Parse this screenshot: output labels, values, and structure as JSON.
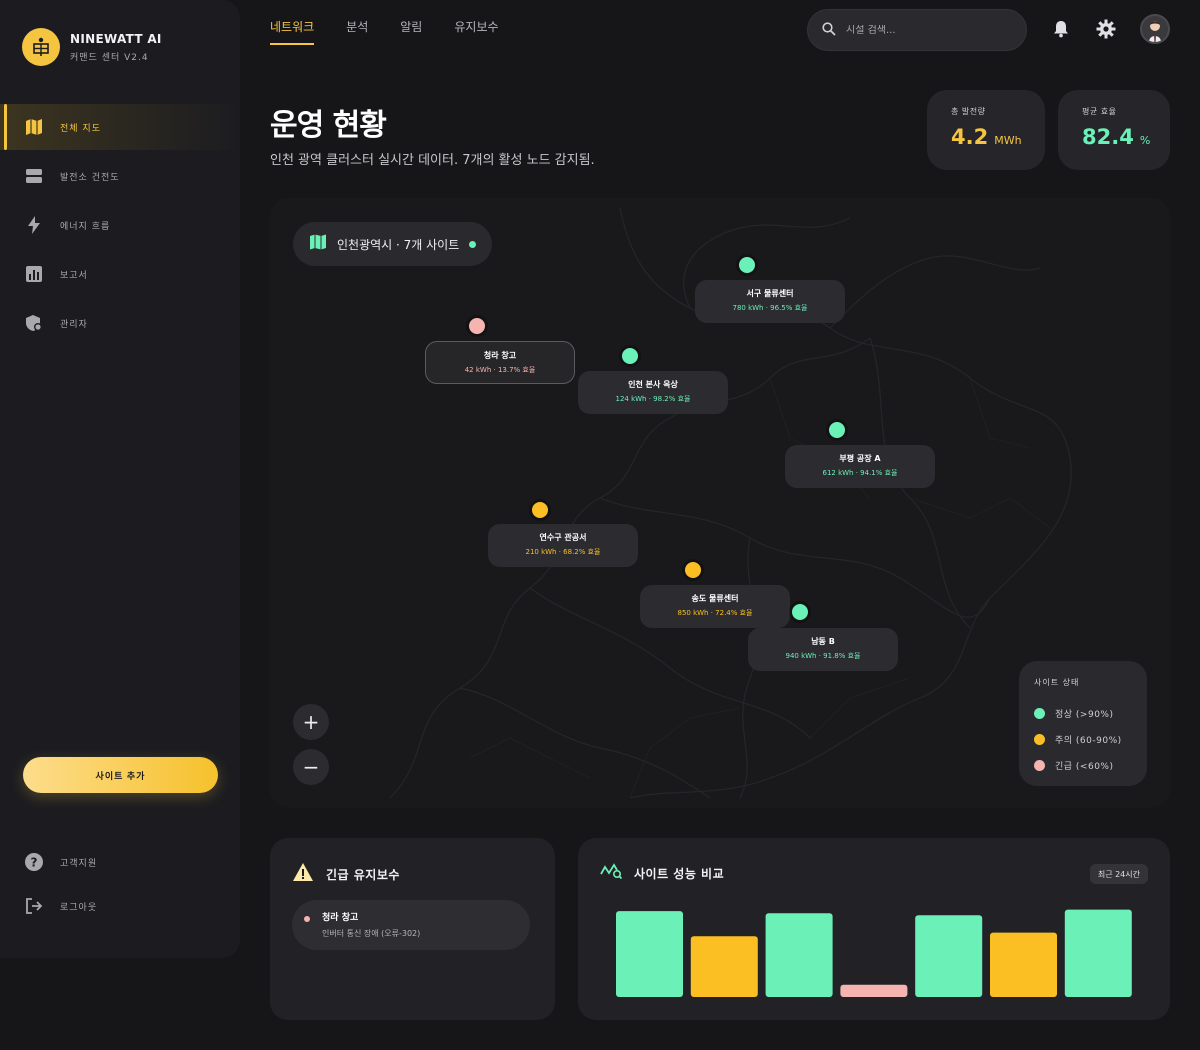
{
  "brand": {
    "name": "NINEWATT AI",
    "subtitle": "커맨드 센터 V2.4"
  },
  "sidebar": {
    "items": [
      {
        "label": "전체 지도",
        "icon": "map-icon",
        "active": true
      },
      {
        "label": "발전소 건전도",
        "icon": "server-icon",
        "active": false
      },
      {
        "label": "에너지 흐름",
        "icon": "bolt-icon",
        "active": false
      },
      {
        "label": "보고서",
        "icon": "bar-chart-icon",
        "active": false
      },
      {
        "label": "관리자",
        "icon": "admin-shield-icon",
        "active": false
      }
    ],
    "add_site_label": "사이트 추가",
    "footer": [
      {
        "label": "고객지원",
        "icon": "help-icon"
      },
      {
        "label": "로그아웃",
        "icon": "logout-icon"
      }
    ]
  },
  "topnav": {
    "tabs": [
      "네트워크",
      "분석",
      "알림",
      "유지보수"
    ],
    "active": "네트워크"
  },
  "search": {
    "placeholder": "시설 검색..."
  },
  "header": {
    "title": "운영 현황",
    "subtitle": "인천 광역 클러스터 실시간 데이터. 7개의 활성 노드 감지됨."
  },
  "stats": [
    {
      "label": "총 발전량",
      "value": "4.2",
      "unit": "MWh",
      "color": "#f5c542"
    },
    {
      "label": "평균 효율",
      "value": "82.4",
      "unit": "%",
      "color": "#6bf0b8"
    }
  ],
  "map": {
    "region": "인천광역시 · 7개 사이트",
    "nodes": [
      {
        "name": "서구 물류센터",
        "meta": "780 kWh · 96.5% 효율",
        "status": "normal"
      },
      {
        "name": "청라 창고",
        "meta": "42 kWh · 13.7% 효율",
        "status": "critical"
      },
      {
        "name": "인천 본사 옥상",
        "meta": "124 kWh · 98.2% 효율",
        "status": "normal"
      },
      {
        "name": "부평 공장 A",
        "meta": "612 kWh · 94.1% 효율",
        "status": "normal"
      },
      {
        "name": "연수구 관공서",
        "meta": "210 kWh · 68.2% 효율",
        "status": "warning"
      },
      {
        "name": "송도 물류센터",
        "meta": "850 kWh · 72.4% 효율",
        "status": "warning"
      },
      {
        "name": "남동 B",
        "meta": "940 kWh · 91.8% 효율",
        "status": "normal"
      }
    ],
    "zoom_in": "+",
    "zoom_out": "−",
    "legend": {
      "title": "사이트 상태",
      "items": [
        {
          "label": "정상 (>90%)",
          "color": "#6bf0b8"
        },
        {
          "label": "주의 (60-90%)",
          "color": "#f5c542"
        },
        {
          "label": "긴급 (<60%)",
          "color": "#f5b4b0"
        }
      ]
    }
  },
  "colors": {
    "normal": "#6bf0b8",
    "warning": "#fbbf24",
    "critical": "#f5b4b0",
    "accent": "#f5c542"
  },
  "maintenance": {
    "title": "긴급 유지보수",
    "items": [
      {
        "name": "청라 창고",
        "desc": "인버터 통신 장애 (오류-302)"
      }
    ]
  },
  "performance": {
    "title": "사이트 성능 비교",
    "badge": "최근 24시간"
  },
  "chart_data": {
    "type": "bar",
    "values": [
      96.5,
      68.2,
      94.1,
      13.7,
      91.8,
      72.4,
      98.2
    ],
    "colors": [
      "#6bf0b8",
      "#fbbf24",
      "#6bf0b8",
      "#f5b4b0",
      "#6bf0b8",
      "#fbbf24",
      "#6bf0b8"
    ],
    "ylim": [
      0,
      100
    ]
  }
}
